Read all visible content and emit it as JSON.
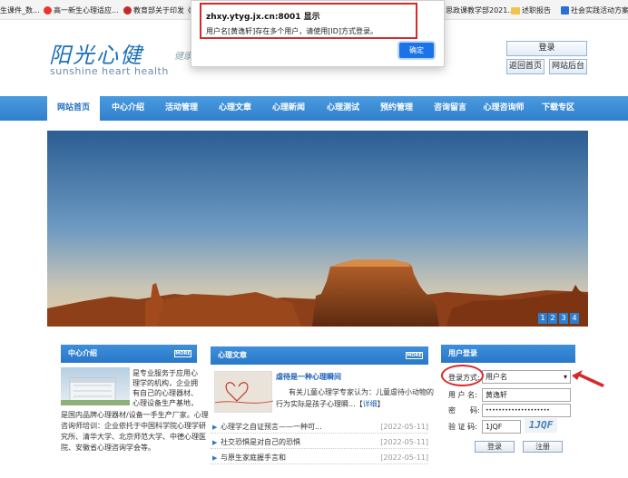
{
  "bookmarks": [
    {
      "label": "生课件_数..."
    },
    {
      "label": "高一新生心理适应..."
    },
    {
      "label": "教育部关于印发《..."
    },
    {
      "label": "思政课教学部2021..."
    },
    {
      "label": "述职报告"
    },
    {
      "label": "社会实践活动方案..."
    }
  ],
  "header": {
    "logo_cn": "阳光心健",
    "logo_en": "sunshine heart health",
    "logo_side": "健康",
    "login_button": "登录",
    "home_button": "返回首页",
    "admin_button": "网站后台"
  },
  "nav": [
    {
      "label": "网站首页"
    },
    {
      "label": "中心介绍"
    },
    {
      "label": "活动管理"
    },
    {
      "label": "心理文章"
    },
    {
      "label": "心理新闻"
    },
    {
      "label": "心理测试"
    },
    {
      "label": "预约管理"
    },
    {
      "label": "咨询留言"
    },
    {
      "label": "心理咨询师"
    },
    {
      "label": "下载专区"
    }
  ],
  "banner": {
    "pages": [
      "1",
      "2",
      "3",
      "4"
    ]
  },
  "intro": {
    "title": "中心介绍",
    "more": "MORE",
    "line1": "是专业服务于应用心",
    "line2": "理学的机构，企业拥",
    "line3": "有自己的心理器材、",
    "line4": "心理设备生产基地，",
    "line5": "是国内品牌心理器材/设备一手生产厂家。心理",
    "line6": "咨询师培训：企业依托于中国科学院心理学研",
    "line7": "究所、清华大学、北京师范大学、中德心理医",
    "line8": "院、安徽省心理咨询学会等。"
  },
  "articles": {
    "title": "心理文章",
    "more": "MORE",
    "featured_title": "虐待是一种心理瞬间",
    "featured_line1": "有关儿童心理学专家认为：儿童虐待小动物的",
    "featured_line2": "行为实际是孩子心理瞬...",
    "featured_link": "详细",
    "items": [
      {
        "title": "心理学之自证预言——一种可...",
        "date": "[2022-05-11]"
      },
      {
        "title": "社交恐惧是对自己的恐惧",
        "date": "[2022-05-11]"
      },
      {
        "title": "与原生家庭握手言和",
        "date": "[2022-05-11]"
      }
    ]
  },
  "login": {
    "title": "用户登录",
    "method_label": "登录方式:",
    "method_value": "用户名",
    "username_label": "用 户 名:",
    "username_value": "黄逸轩",
    "password_label": "密　　码:",
    "password_value": "••••••••••••••••••••",
    "captcha_label": "验 证 码:",
    "captcha_value": "1JQF",
    "captcha_image": "1JQF",
    "login_button": "登录",
    "register_button": "注册"
  },
  "dialog": {
    "title": "zhxy.ytyg.jx.cn:8001 显示",
    "message": "用户名[黄逸轩]存在多个用户，请使用[ID]方式登录。",
    "ok_button": "确定"
  },
  "colors": {
    "nav_blue": "#2f80cc",
    "accent_red": "#d62a2a",
    "ok_blue": "#1a73e8"
  }
}
